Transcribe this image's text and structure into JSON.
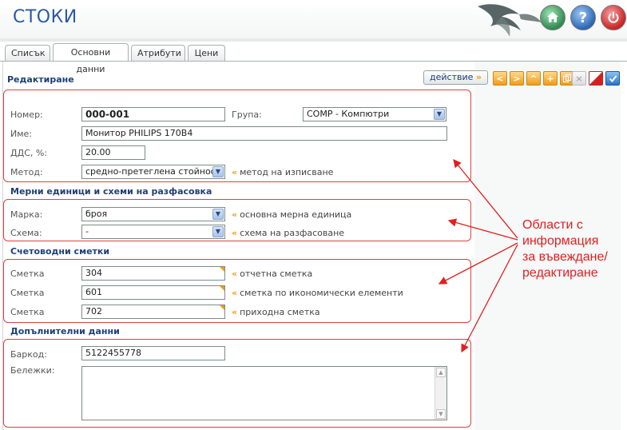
{
  "header": {
    "title": "СТОКИ",
    "buttons": [
      {
        "name": "home",
        "icon": "home-icon"
      },
      {
        "name": "help",
        "icon": "question-icon",
        "label": "?"
      },
      {
        "name": "logout",
        "icon": "power-icon"
      }
    ]
  },
  "tabs": [
    {
      "label": "Списък",
      "active": false
    },
    {
      "label": "Основни данни",
      "active": true
    },
    {
      "label": "Атрибути",
      "active": false
    },
    {
      "label": "Цени",
      "active": false
    }
  ],
  "editing": {
    "title": "Редактиране",
    "action_label": "действие",
    "action_arrow": "»",
    "toolbar_icons": [
      "arrow-left-icon",
      "arrow-right-icon",
      "arrow-up-icon",
      "add-icon",
      "copy-icon",
      "close-icon",
      "delete-icon",
      "save-icon"
    ],
    "toolbar_glyphs": {
      "left": "<",
      "right": ">",
      "up": "^",
      "add": "+",
      "close": "×"
    }
  },
  "basic": {
    "number_label": "Номер:",
    "number_value": "000-001",
    "group_label": "Група:",
    "group_value": "COMP - Компютри",
    "name_label": "Име:",
    "name_value": "Монитор PHILIPS 170B4",
    "vat_label": "ДДС, %:",
    "vat_value": "20.00",
    "method_label": "Метод:",
    "method_value": "средно-претеглена стойност",
    "method_hint": "метод на изписване"
  },
  "units": {
    "title": "Мерни единици и схеми на разфасовка",
    "brand_label": "Марка:",
    "brand_value": "броя",
    "brand_hint": "основна мерна единица",
    "scheme_label": "Схема:",
    "scheme_value": "-",
    "scheme_hint": "схема на разфасоване"
  },
  "accounts": {
    "title": "Счетоводни сметки",
    "rows": [
      {
        "label": "Сметка",
        "value": "304",
        "hint": "отчетна сметка"
      },
      {
        "label": "Сметка",
        "value": "601",
        "hint": "сметка по икономически елементи"
      },
      {
        "label": "Сметка",
        "value": "702",
        "hint": "приходна сметка"
      }
    ]
  },
  "additional": {
    "title": "Допълнителни данни",
    "barcode_label": "Баркод:",
    "barcode_value": "5122455778",
    "notes_label": "Бележки:",
    "notes_value": ""
  },
  "annotation": {
    "lines": [
      "Области с",
      "информация",
      "за въвеждане/",
      "редактиране"
    ],
    "color": "#e02020"
  },
  "colors": {
    "title_blue": "#2a5aa8",
    "section_blue": "#1e3f7a",
    "accent_orange": "#f39a18",
    "highlight_red": "#e04040"
  }
}
